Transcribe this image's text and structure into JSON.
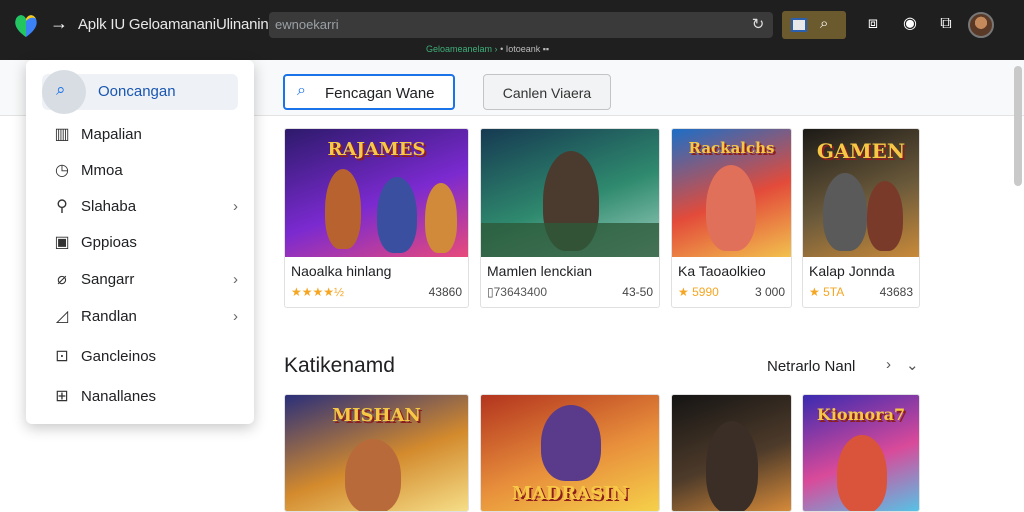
{
  "topbar": {
    "app_title": "Aplk IU GeloamananiUlinanin",
    "address_text": "ewnoekarri",
    "sub_bar_green": "Geloameanelam ›",
    "sub_bar_text": "• Iotoeank ▪▪"
  },
  "toolbar": {
    "primary_button": "Fencagan Wane",
    "secondary_button": "Canlen Viaera"
  },
  "menu": {
    "search_label": "Ooncangan",
    "items": [
      {
        "label": "Mapalian",
        "icon": "chart-icon",
        "has_submenu": false
      },
      {
        "label": "Mmoa",
        "icon": "clock-icon",
        "has_submenu": false
      },
      {
        "label": "Slahaba",
        "icon": "person-icon",
        "has_submenu": true
      },
      {
        "label": "Gppioas",
        "icon": "square-icon",
        "has_submenu": false
      },
      {
        "label": "Sangarr",
        "icon": "tag-icon",
        "has_submenu": true
      },
      {
        "label": "Randlan",
        "icon": "pen-icon",
        "has_submenu": true
      },
      {
        "label": "Gancleinos",
        "icon": "bag-icon",
        "has_submenu": false
      },
      {
        "label": "Nanallanes",
        "icon": "grid-icon",
        "has_submenu": false
      }
    ]
  },
  "games_row1": [
    {
      "art_title": "RAJAMES",
      "name": "Naoalka hinlang",
      "rating": "★★★★½",
      "count": "43860",
      "colors": [
        "#2d1a6b",
        "#7b2ad0",
        "#e84a7a"
      ]
    },
    {
      "art_title": "",
      "name": "Mamlen lenckian",
      "rating": "▯73643400",
      "count": "43-50",
      "colors": [
        "#163a52",
        "#2f8a6e",
        "#9fd0c0"
      ]
    },
    {
      "art_title": "Rackalchs",
      "name": "Ka Taoaolkieo",
      "rating": "★ 5990",
      "count": "3 000",
      "colors": [
        "#1d6ec7",
        "#e34b3a",
        "#f2c14e"
      ]
    },
    {
      "art_title": "GAMEN",
      "name": "Kalap Jonnda",
      "rating": "★ 5TA",
      "count": "43683",
      "colors": [
        "#1c1a17",
        "#6b5a3b",
        "#c98a3a"
      ]
    }
  ],
  "section": {
    "title": "Katikenamd",
    "more_label": "Netrarlo Nanl",
    "chevron_right": "›",
    "chevron_down": "⌄"
  },
  "games_row2": [
    {
      "art_title": "MISHAN",
      "colors": [
        "#2a2f7a",
        "#d38a2d",
        "#f6e08a"
      ]
    },
    {
      "art_title": "MADRASIN",
      "colors": [
        "#b3341e",
        "#e8903c",
        "#f6d24a"
      ]
    },
    {
      "art_title": "",
      "colors": [
        "#141414",
        "#4e3b2a",
        "#d98c3a"
      ]
    },
    {
      "art_title": "Kiomora7",
      "colors": [
        "#3a2ab0",
        "#d94a9a",
        "#52c6e8"
      ]
    }
  ],
  "colors": {
    "accent": "#1a73e8",
    "topbar": "#1f1f1f",
    "star": "#f5a623"
  }
}
